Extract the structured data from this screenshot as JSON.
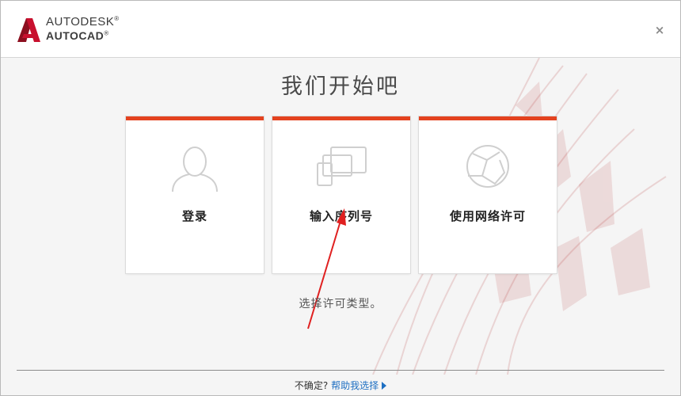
{
  "header": {
    "brand_top": "AUTODESK",
    "brand_bottom": "AUTOCAD",
    "brand_top_mark": "®",
    "brand_bottom_mark": "®",
    "close_label": "×"
  },
  "main": {
    "title": "我们开始吧",
    "cards": [
      {
        "label": "登录",
        "icon": "user-icon"
      },
      {
        "label": "输入序列号",
        "icon": "devices-icon"
      },
      {
        "label": "使用网络许可",
        "icon": "network-globe-icon"
      }
    ],
    "hint": "选择许可类型。"
  },
  "footer": {
    "question": "不确定?",
    "help_link": "帮助我选择"
  },
  "colors": {
    "accent": "#e4421f",
    "link": "#1e6fc2",
    "logo_red": "#c8102e"
  }
}
